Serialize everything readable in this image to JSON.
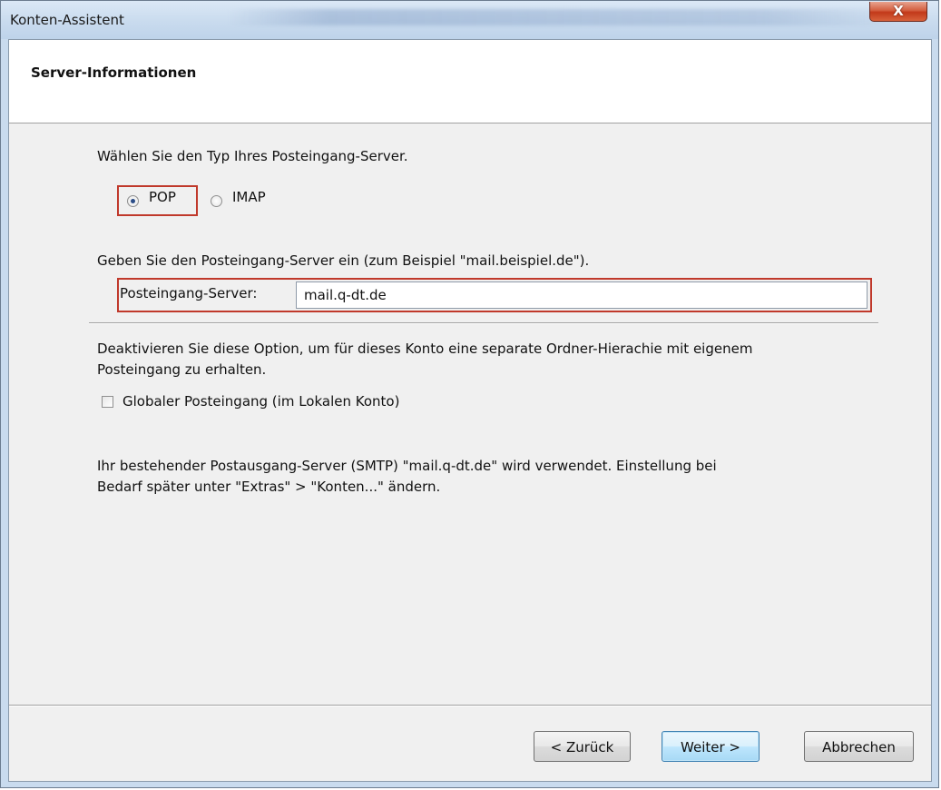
{
  "window": {
    "title": "Konten-Assistent",
    "close_label": "X"
  },
  "header": {
    "title": "Server-Informationen"
  },
  "server_type": {
    "prompt": "Wählen Sie den Typ Ihres Posteingang-Server.",
    "options": [
      {
        "label": "POP",
        "checked": true
      },
      {
        "label": "IMAP",
        "checked": false
      }
    ]
  },
  "incoming_server": {
    "prompt": "Geben Sie den Posteingang-Server ein (zum Beispiel \"mail.beispiel.de\").",
    "label": "Posteingang-Server:",
    "value": "mail.q-dt.de"
  },
  "global_inbox": {
    "description_line1": "Deaktivieren Sie diese Option, um für dieses Konto eine separate Ordner-Hierachie mit eigenem",
    "description_line2": "Posteingang zu erhalten.",
    "checkbox_label": "Globaler Posteingang (im Lokalen Konto)",
    "checked": false
  },
  "smtp_note": {
    "line1": "Ihr bestehender Postausgang-Server (SMTP) \"mail.q-dt.de\" wird verwendet. Einstellung bei",
    "line2": "Bedarf später unter \"Extras\" > \"Konten...\" ändern."
  },
  "buttons": {
    "back": "< Zurück",
    "next": "Weiter >",
    "cancel": "Abbrechen"
  }
}
